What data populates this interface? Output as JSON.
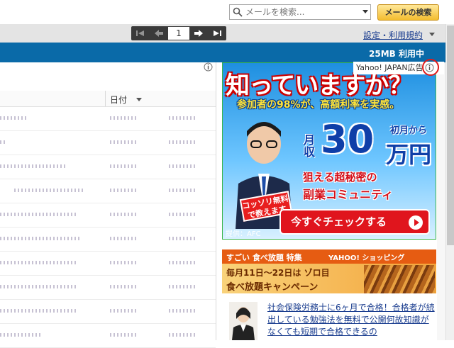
{
  "search": {
    "placeholder": "メールを検索...",
    "button_label": "メールの検索"
  },
  "pager": {
    "page": "1"
  },
  "header": {
    "settings_label": "設定・利用規約",
    "usage": "25MB 利用中"
  },
  "list": {
    "date_column": "日付"
  },
  "ad": {
    "label": "Yahoo! JAPAN広告",
    "banner": {
      "headline": "知っていますか？",
      "subline": "参加者の98%が、高額利率を実感。",
      "monthly": "月収",
      "from_first_month": "初月から",
      "amount": "30",
      "unit": "万円",
      "tagline1": "狙える超秘密の",
      "tagline2": "副業コミュニティ",
      "badge": "コッソリ無料で教えます",
      "cta": "今すぐチェックする",
      "provider": "提供：AFC"
    },
    "banner2": {
      "line1": "すごい 食べ放題 特集",
      "line2": "YAHOO! ショッピング",
      "line3": "毎月11日～22日は ゾロ目",
      "line4": "食べ放題キャンペーン"
    },
    "text_ad": "社会保険労務士に6ヶ月で合格！合格者が続出している勉強法を無料で公開何故知識がなくても短期で合格できるの"
  }
}
